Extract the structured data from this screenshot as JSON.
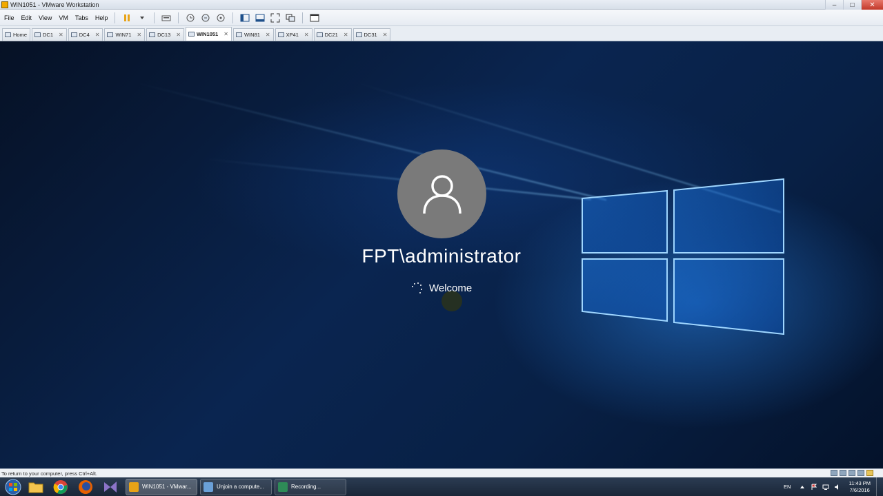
{
  "window": {
    "title": "WIN1051 - VMware Workstation"
  },
  "menu": {
    "items": [
      "File",
      "Edit",
      "View",
      "VM",
      "Tabs",
      "Help"
    ]
  },
  "tabs": [
    {
      "label": "Home",
      "active": false,
      "closable": false
    },
    {
      "label": "DC1",
      "active": false,
      "closable": true
    },
    {
      "label": "DC4",
      "active": false,
      "closable": true
    },
    {
      "label": "WIN71",
      "active": false,
      "closable": true
    },
    {
      "label": "DC13",
      "active": false,
      "closable": true
    },
    {
      "label": "WIN1051",
      "active": true,
      "closable": true
    },
    {
      "label": "WIN81",
      "active": false,
      "closable": true
    },
    {
      "label": "XP41",
      "active": false,
      "closable": true
    },
    {
      "label": "DC21",
      "active": false,
      "closable": true
    },
    {
      "label": "DC31",
      "active": false,
      "closable": true
    }
  ],
  "login": {
    "username": "FPT\\administrator",
    "status": "Welcome"
  },
  "statusbar": {
    "text": "To return to your computer, press Ctrl+Alt."
  },
  "taskbar": {
    "pinned": [
      "start-orb",
      "explorer",
      "chrome",
      "firefox",
      "visual-studio"
    ],
    "tasks": [
      {
        "label": "WIN1051 - VMwar...",
        "active": true,
        "color": "#e8a317"
      },
      {
        "label": "Unjoin a compute...",
        "active": false,
        "color": "#6aa0d8"
      },
      {
        "label": "Recording...",
        "active": false,
        "color": "#2e8b57"
      }
    ],
    "tray": {
      "lang": "EN",
      "time": "11:43 PM",
      "date": "7/6/2016"
    }
  },
  "colors": {
    "accent": "#1e73d8",
    "avatar": "#7a7a7a"
  }
}
